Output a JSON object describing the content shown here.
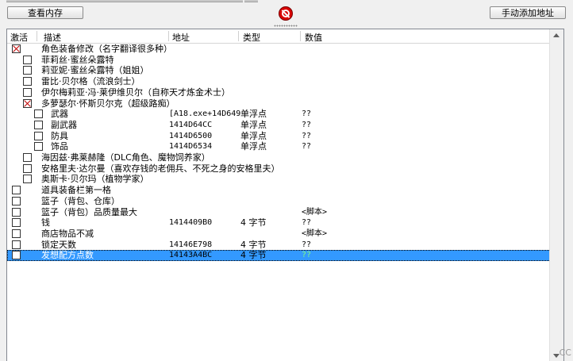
{
  "toolbar": {
    "memory_view_label": "查看内存",
    "add_address_label": "手动添加地址",
    "stop_icon": "stop-icon"
  },
  "columns": {
    "active": "激活",
    "description": "描述",
    "address": "地址",
    "type": "类型",
    "value": "数值"
  },
  "rows": [
    {
      "level": 0,
      "checked": true,
      "desc": "角色装备修改（名字翻译很多种）",
      "addr": "",
      "type": "",
      "value": ""
    },
    {
      "level": 1,
      "checked": false,
      "desc": "菲莉丝·蜜丝朵露特",
      "addr": "",
      "type": "",
      "value": ""
    },
    {
      "level": 1,
      "checked": false,
      "desc": "莉亚妮·蜜丝朵露特（姐姐）",
      "addr": "",
      "type": "",
      "value": ""
    },
    {
      "level": 1,
      "checked": false,
      "desc": "雷比·贝尔格（流浪剑士）",
      "addr": "",
      "type": "",
      "value": ""
    },
    {
      "level": 1,
      "checked": false,
      "desc": "伊尔梅莉亚·冯·莱伊维贝尔（自称天才炼金术士）",
      "addr": "",
      "type": "",
      "value": ""
    },
    {
      "level": 1,
      "checked": true,
      "desc": "多萝瑟尔·怀斯贝尔克（超级路痴）",
      "addr": "",
      "type": "",
      "value": ""
    },
    {
      "level": 2,
      "checked": false,
      "desc": "武器",
      "addr": "[A18.exe+14D649",
      "type": "单浮点",
      "value": "??"
    },
    {
      "level": 2,
      "checked": false,
      "desc": "副武器",
      "addr": "1414D64CC",
      "type": "单浮点",
      "value": "??"
    },
    {
      "level": 2,
      "checked": false,
      "desc": "防具",
      "addr": "1414D6500",
      "type": "单浮点",
      "value": "??"
    },
    {
      "level": 2,
      "checked": false,
      "desc": "饰品",
      "addr": "1414D6534",
      "type": "单浮点",
      "value": "??"
    },
    {
      "level": 1,
      "checked": false,
      "desc": "海因兹·弗莱赫隆（DLC角色、魔物饲养家）",
      "addr": "",
      "type": "",
      "value": ""
    },
    {
      "level": 1,
      "checked": false,
      "desc": "安格里夫·达尔曼（喜欢存钱的老佣兵、不死之身的安格里夫）",
      "addr": "",
      "type": "",
      "value": ""
    },
    {
      "level": 1,
      "checked": false,
      "desc": "奥斯卡·贝尔玛（植物学家）",
      "addr": "",
      "type": "",
      "value": ""
    },
    {
      "level": 0,
      "checked": false,
      "desc": "道具装备栏第一格",
      "addr": "",
      "type": "",
      "value": ""
    },
    {
      "level": 0,
      "checked": false,
      "desc": "篮子（背包、仓库）",
      "addr": "",
      "type": "",
      "value": ""
    },
    {
      "level": 0,
      "checked": false,
      "desc": "篮子（背包）品质量最大",
      "addr": "",
      "type": "",
      "value": "<脚本>"
    },
    {
      "level": 0,
      "checked": false,
      "desc": "钱",
      "addr": "1414409B0",
      "type": "4 字节",
      "value": "??"
    },
    {
      "level": 0,
      "checked": false,
      "desc": "商店物品不减",
      "addr": "",
      "type": "",
      "value": "<脚本>"
    },
    {
      "level": 0,
      "checked": false,
      "desc": "锁定天数",
      "addr": "14146E798",
      "type": "4 字节",
      "value": "??"
    },
    {
      "level": 0,
      "checked": false,
      "desc": "发想配方点数",
      "addr": "14143A4BC",
      "type": "4 字节",
      "value": "??",
      "selected": true
    }
  ],
  "footer_fragment": "CC"
}
